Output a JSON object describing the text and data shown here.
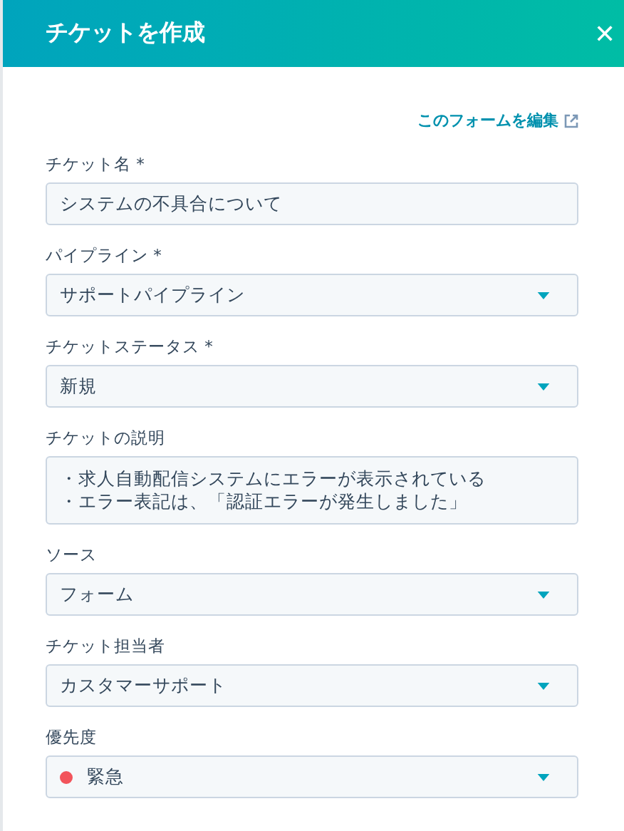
{
  "header": {
    "title": "チケットを作成",
    "close": "✕"
  },
  "edit_link": "このフォームを編集",
  "fields": [
    {
      "kind": "text",
      "label": "チケット名 *",
      "value": "システムの不具合について"
    },
    {
      "kind": "select",
      "label": "パイプライン *",
      "value": "サポートパイプライン"
    },
    {
      "kind": "select",
      "label": "チケットステータス *",
      "value": "新規"
    },
    {
      "kind": "textarea",
      "label": "チケットの説明",
      "lines": [
        "・求人自動配信システムにエラーが表示されている",
        "・エラー表記は、「認証エラーが発生しました」"
      ]
    },
    {
      "kind": "select",
      "label": "ソース",
      "value": "フォーム"
    },
    {
      "kind": "select",
      "label": "チケット担当者",
      "value": "カスタマーサポート"
    },
    {
      "kind": "select",
      "label": "優先度",
      "value": "緊急",
      "color": "#f2545b"
    }
  ]
}
